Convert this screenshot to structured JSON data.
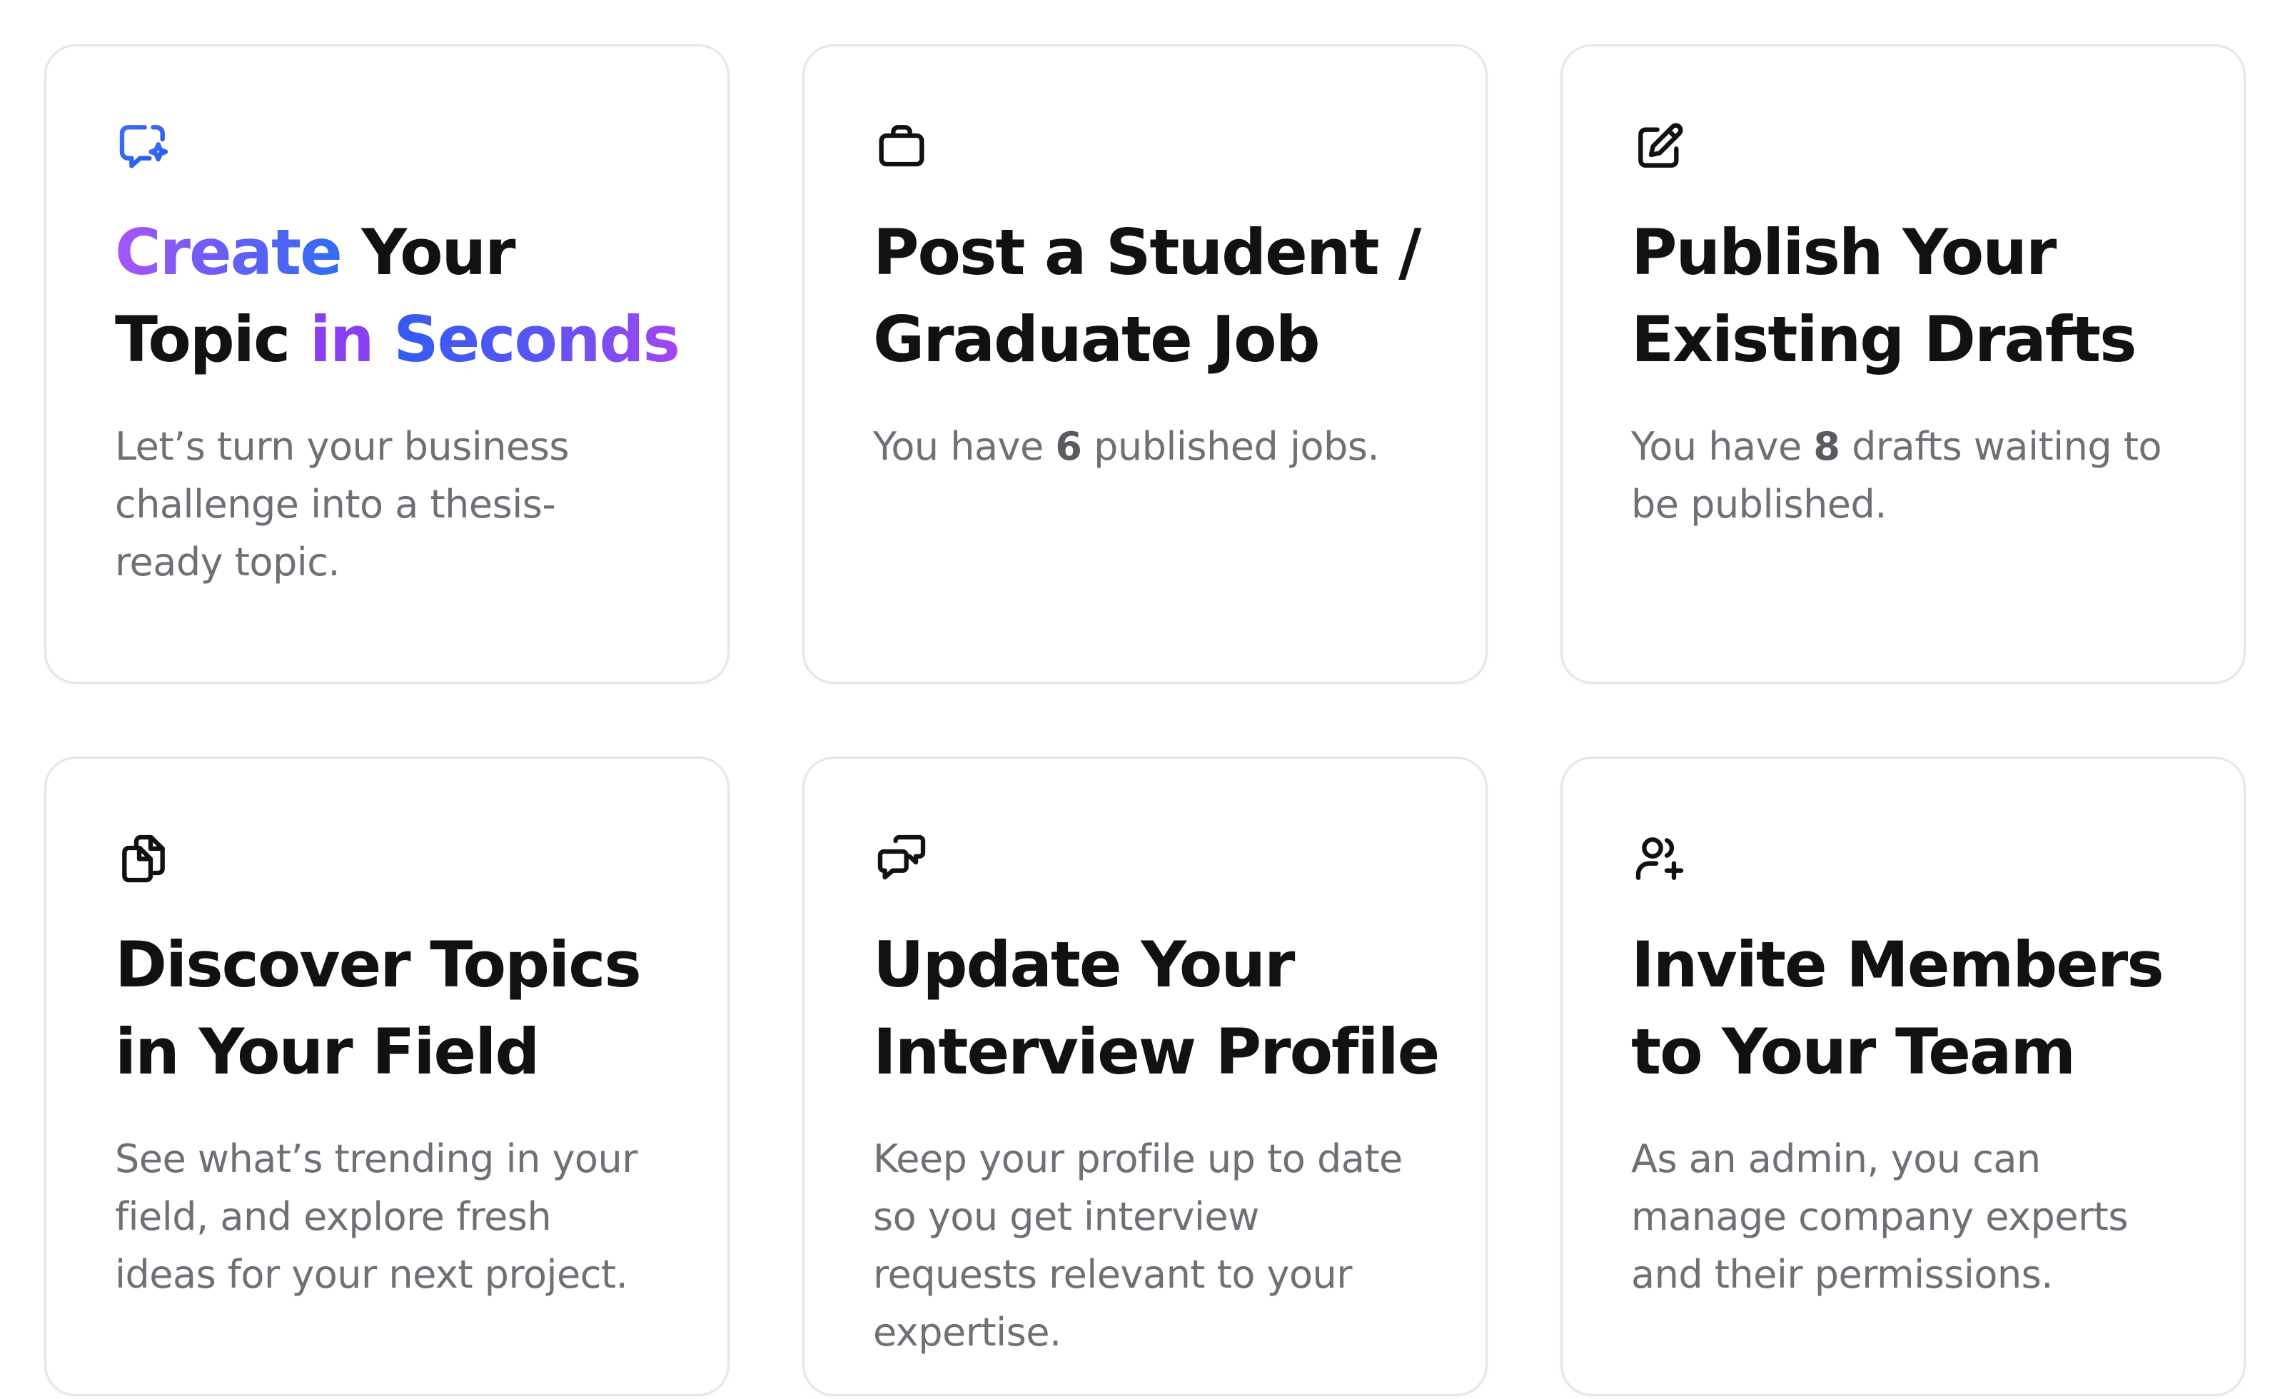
{
  "cards": [
    {
      "icon": "chat-sparkle-icon",
      "title_parts": {
        "create": "Create",
        "your": " Your",
        "topic": "Topic ",
        "in": "in",
        "seconds": " Seconds"
      },
      "description": "Let’s turn your business challenge into a thesis-ready topic.",
      "accent_colors": [
        "#a855f7",
        "#2f6df3"
      ]
    },
    {
      "icon": "briefcase-icon",
      "title_lines": [
        "Post a Student /",
        "Graduate Job"
      ],
      "description_parts": {
        "before": "You have ",
        "count": "6",
        "after": " published jobs."
      }
    },
    {
      "icon": "pencil-square-icon",
      "title_lines": [
        "Publish Your",
        "Existing Drafts"
      ],
      "description_parts": {
        "before": "You have ",
        "count": "8",
        "after": " drafts waiting to be published."
      }
    },
    {
      "icon": "documents-icon",
      "title_lines": [
        "Discover Topics",
        "in Your Field"
      ],
      "description": "See what’s trending in your field, and explore fresh ideas for your next project."
    },
    {
      "icon": "chat-bubbles-icon",
      "title_lines": [
        "Update Your",
        "Interview Profile"
      ],
      "description": "Keep your profile up to date so you get interview requests relevant to your expertise."
    },
    {
      "icon": "user-plus-icon",
      "title_lines": [
        "Invite Members",
        "to Your Team"
      ],
      "description": "As an admin, you can manage company experts and their permissions."
    }
  ]
}
